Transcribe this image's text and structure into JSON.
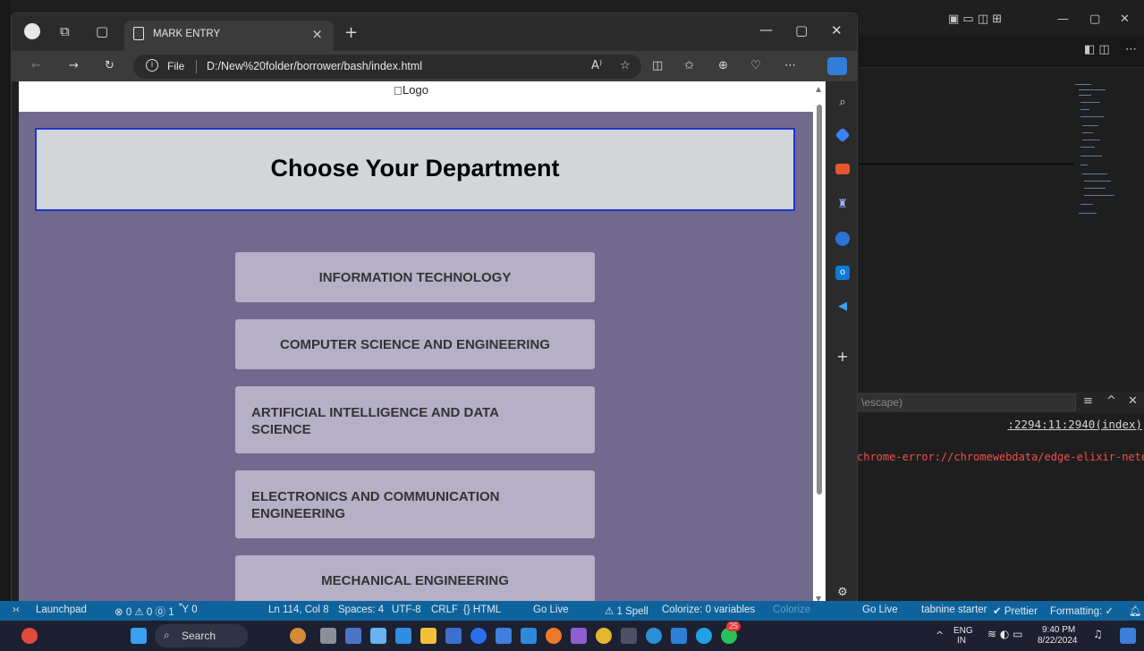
{
  "browser": {
    "tab_title": "MARK ENTRY",
    "close_glyph": "×",
    "new_tab_glyph": "+",
    "file_label": "File",
    "url": "D:/New%20folder/borrower/bash/index.html",
    "read_aloud": "A⁾"
  },
  "page": {
    "logo_alt": "Logo",
    "heading": "Choose Your Department",
    "departments": [
      "INFORMATION TECHNOLOGY",
      "COMPUTER SCIENCE AND ENGINEERING",
      "ARTIFICIAL INTELLIGENCE AND DATA SCIENCE",
      "ELECTRONICS AND COMMUNICATION ENGINEERING",
      "MECHANICAL ENGINEERING"
    ]
  },
  "vscode": {
    "panel_filter": "\\escape)",
    "console_link": ":2294:11:2940(index)",
    "console_error": "chrome-error://chromewebdata/edge-elixir-nete",
    "status": {
      "launchpad": "Launchpad",
      "problems": "⊗ 0 ⚠ 0 ⓪ 1",
      "ports": "Ὗ 0",
      "position": "Ln 114, Col 8",
      "spaces": "Spaces: 4",
      "encoding": "UTF-8",
      "eol": "CRLF",
      "language": "{} HTML",
      "golive1": "Go Live",
      "spell": "⚠ 1 Spell",
      "colorize": "Colorize: 0 variables",
      "colorize2": "Colorize",
      "golive2": "Go Live",
      "tabnine": "tabnine starter",
      "prettier": "✔ Prettier",
      "formatting": "Formatting: ✓"
    }
  },
  "taskbar": {
    "search_label": "Search",
    "lang_top": "ENG",
    "lang_bottom": "IN",
    "time": "9:40 PM",
    "date": "8/22/2024",
    "badge": "25"
  },
  "colors": {
    "page_bg": "#72698f",
    "button_bg": "#b5b0c6",
    "heading_bg": "#d3d6d9",
    "heading_border": "#2233cc",
    "statusbar": "#0e639c"
  }
}
